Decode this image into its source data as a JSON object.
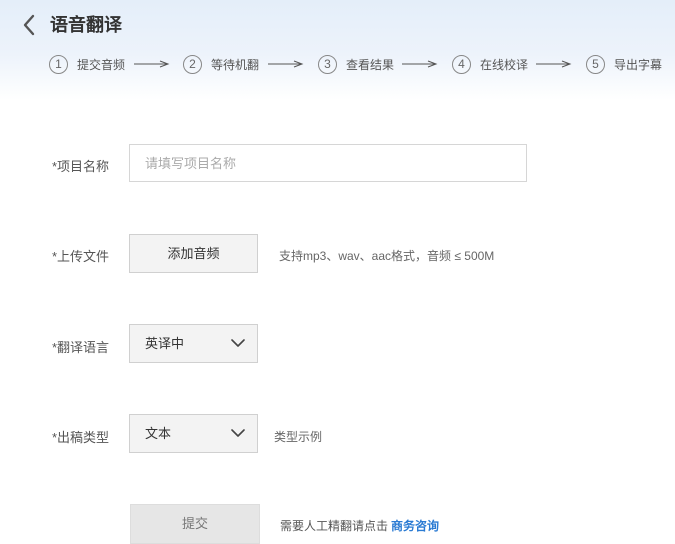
{
  "header": {
    "title": "语音翻译",
    "back_icon": "chevron-left-icon"
  },
  "steps": [
    {
      "num": "1",
      "label": "提交音频"
    },
    {
      "num": "2",
      "label": "等待机翻"
    },
    {
      "num": "3",
      "label": "查看结果"
    },
    {
      "num": "4",
      "label": "在线校译"
    },
    {
      "num": "5",
      "label": "导出字幕"
    }
  ],
  "form": {
    "project_name": {
      "label": "*项目名称",
      "value": "",
      "placeholder": "请填写项目名称"
    },
    "upload": {
      "label": "*上传文件",
      "button": "添加音频",
      "hint": "支持mp3、wav、aac格式，音频 ≤ 500M"
    },
    "language": {
      "label": "*翻译语言",
      "selected": "英译中"
    },
    "output_type": {
      "label": "*出稿类型",
      "selected": "文本",
      "hint": "类型示例"
    }
  },
  "footer": {
    "submit": "提交",
    "consult_text": "需要人工精翻请点击",
    "consult_link": "商务咨询"
  },
  "colors": {
    "link": "#2b7bd3",
    "header_bg": "#e4eef9"
  }
}
